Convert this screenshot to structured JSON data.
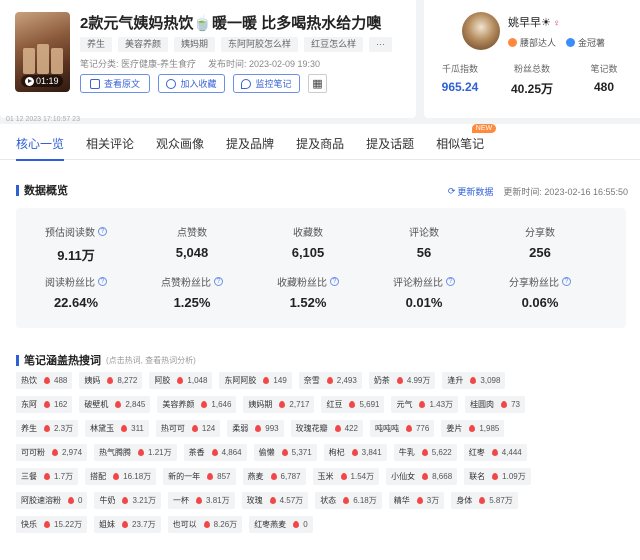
{
  "note": {
    "thumb_duration": "01:19",
    "title": "2款元气姨妈热饮🍵暖一暖 比多喝热水给力噢",
    "tags": [
      "养生",
      "美容养颜",
      "姨妈期",
      "东阿阿胶怎么样",
      "红豆怎么样",
      "···"
    ],
    "category": "笔记分类: 医疗健康-养生食疗",
    "published": "发布时间: 2023-02-09 19:30",
    "buttons": {
      "view": "查看原文",
      "collect": "加入收藏",
      "monitor": "监控笔记"
    },
    "qr_icon": "qr-code-icon"
  },
  "author": {
    "name": "姚早早☀",
    "gender": "♀",
    "badges": [
      "腰部达人",
      "金冠薯"
    ],
    "stats": [
      {
        "label": "千瓜指数",
        "value": "965.24"
      },
      {
        "label": "粉丝总数",
        "value": "40.25万"
      },
      {
        "label": "笔记数",
        "value": "480"
      }
    ]
  },
  "faint_text": "01 12 2023 17:10:57 23",
  "tabs": [
    "核心一览",
    "相关评论",
    "观众画像",
    "提及品牌",
    "提及商品",
    "提及话题",
    "相似笔记"
  ],
  "tab_badge": "NEW",
  "overview": {
    "title": "数据概览",
    "refresh": "更新数据",
    "update_time": "更新时间: 2023-02-16 16:55:50",
    "metrics": [
      {
        "label": "预估阅读数",
        "value": "9.11万",
        "q": true
      },
      {
        "label": "点赞数",
        "value": "5,048",
        "q": false
      },
      {
        "label": "收藏数",
        "value": "6,105",
        "q": false
      },
      {
        "label": "评论数",
        "value": "56",
        "q": false
      },
      {
        "label": "分享数",
        "value": "256",
        "q": false
      },
      {
        "label": "阅读粉丝比",
        "value": "22.64%",
        "q": true
      },
      {
        "label": "点赞粉丝比",
        "value": "1.25%",
        "q": true
      },
      {
        "label": "收藏粉丝比",
        "value": "1.52%",
        "q": true
      },
      {
        "label": "评论粉丝比",
        "value": "0.01%",
        "q": true
      },
      {
        "label": "分享粉丝比",
        "value": "0.06%",
        "q": true
      }
    ]
  },
  "keywords": {
    "title": "笔记涵盖热搜词",
    "hint": "(点击热词, 查看热词分析)",
    "rows": [
      [
        [
          "热饮",
          "488"
        ],
        [
          "姨妈",
          "8,272"
        ],
        [
          "阿胶",
          "1,048"
        ],
        [
          "东阿阿胶",
          "149"
        ],
        [
          "奈雪",
          "2,493"
        ],
        [
          "奶茶",
          "4.99万"
        ],
        [
          "逢升",
          "3,098"
        ]
      ],
      [
        [
          "东阿",
          "162"
        ],
        [
          "破壁机",
          "2,845"
        ],
        [
          "美容养颜",
          "1,646"
        ],
        [
          "姨妈期",
          "2,717"
        ],
        [
          "红豆",
          "5,691"
        ],
        [
          "元气",
          "1.43万"
        ],
        [
          "桂圆肉",
          "73"
        ]
      ],
      [
        [
          "养生",
          "2.3万"
        ],
        [
          "林黛玉",
          "311"
        ],
        [
          "热可可",
          "124"
        ],
        [
          "柔弱",
          "993"
        ],
        [
          "玫瑰花瓣",
          "422"
        ],
        [
          "吨吨吨",
          "776"
        ],
        [
          "姜片",
          "1,985"
        ]
      ],
      [
        [
          "可可粉",
          "2,974"
        ],
        [
          "热气腾腾",
          "1.21万"
        ],
        [
          "茶香",
          "4,864"
        ],
        [
          "偷懒",
          "5,371"
        ],
        [
          "枸杞",
          "3,841"
        ],
        [
          "牛乳",
          "5,622"
        ],
        [
          "红枣",
          "4,444"
        ]
      ],
      [
        [
          "三餐",
          "1.7万"
        ],
        [
          "搭配",
          "16.18万"
        ],
        [
          "新的一年",
          "857"
        ],
        [
          "燕麦",
          "6,787"
        ],
        [
          "玉米",
          "1.54万"
        ],
        [
          "小仙女",
          "8,668"
        ],
        [
          "联名",
          "1.09万"
        ]
      ],
      [
        [
          "阿胶速溶粉",
          "0"
        ],
        [
          "牛奶",
          "3.21万"
        ],
        [
          "一杯",
          "3.81万"
        ],
        [
          "玫瑰",
          "4.57万"
        ],
        [
          "状态",
          "6.18万"
        ],
        [
          "精华",
          "3万"
        ],
        [
          "身体",
          "5.87万"
        ]
      ],
      [
        [
          "快乐",
          "15.22万"
        ],
        [
          "姐妹",
          "23.7万"
        ],
        [
          "也可以",
          "8.26万"
        ],
        [
          "红枣燕麦",
          "0"
        ]
      ]
    ]
  }
}
